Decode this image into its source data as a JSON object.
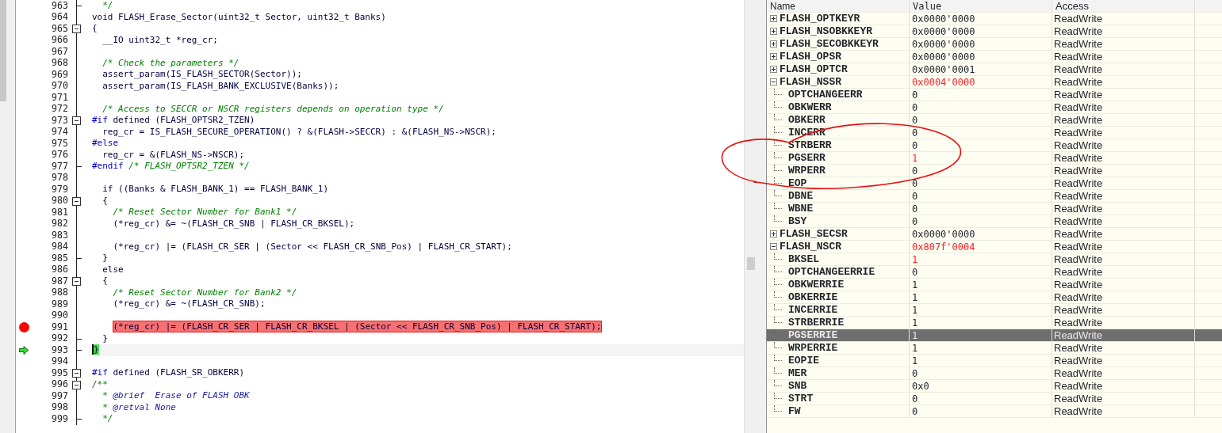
{
  "editor": {
    "lines": [
      {
        "number": "963",
        "fold_end": true,
        "tokens": [
          {
            "kind": "comment",
            "text": "  */"
          }
        ]
      },
      {
        "number": "964",
        "tokens": [
          {
            "kind": "code",
            "text": "void FLASH_Erase_Sector(uint32_t Sector, uint32_t Banks)"
          }
        ]
      },
      {
        "number": "965",
        "fold_start": true,
        "tokens": [
          {
            "kind": "code",
            "text": "{"
          }
        ]
      },
      {
        "number": "966",
        "tokens": [
          {
            "kind": "code",
            "text": "  __IO uint32_t *reg_cr;"
          }
        ]
      },
      {
        "number": "967"
      },
      {
        "number": "968",
        "tokens": [
          {
            "kind": "comment",
            "text": "  /* Check the parameters */"
          }
        ]
      },
      {
        "number": "969",
        "tokens": [
          {
            "kind": "code",
            "text": "  assert_param(IS_FLASH_SECTOR(Sector));"
          }
        ]
      },
      {
        "number": "970",
        "tokens": [
          {
            "kind": "code",
            "text": "  assert_param(IS_FLASH_BANK_EXCLUSIVE(Banks));"
          }
        ]
      },
      {
        "number": "971"
      },
      {
        "number": "972",
        "tokens": [
          {
            "kind": "comment",
            "text": "  /* Access to SECCR or NSCR registers depends on operation type */"
          }
        ]
      },
      {
        "number": "973",
        "fold_start": true,
        "tokens": [
          {
            "kind": "directive",
            "text": "#if"
          },
          {
            "kind": "code",
            "text": " defined (FLASH_OPTSR2_TZEN)"
          }
        ]
      },
      {
        "number": "974",
        "tokens": [
          {
            "kind": "code",
            "text": "  reg_cr = IS_FLASH_SECURE_OPERATION() ? &(FLASH->SECCR) : &(FLASH_NS->NSCR);"
          }
        ]
      },
      {
        "number": "975",
        "tokens": [
          {
            "kind": "directive",
            "text": "#else"
          }
        ]
      },
      {
        "number": "976",
        "tokens": [
          {
            "kind": "code",
            "text": "  reg_cr = &(FLASH_NS->NSCR);"
          }
        ]
      },
      {
        "number": "977",
        "fold_end": true,
        "tokens": [
          {
            "kind": "directive",
            "text": "#endif"
          },
          {
            "kind": "comment",
            "text": " /* FLASH_OPTSR2_TZEN */"
          }
        ]
      },
      {
        "number": "978"
      },
      {
        "number": "979",
        "tokens": [
          {
            "kind": "code",
            "text": "  if ((Banks & FLASH_BANK_1) == FLASH_BANK_1)"
          }
        ]
      },
      {
        "number": "980",
        "fold_start": true,
        "tokens": [
          {
            "kind": "code",
            "text": "  {"
          }
        ]
      },
      {
        "number": "981",
        "tokens": [
          {
            "kind": "comment",
            "text": "    /* Reset Sector Number for Bank1 */"
          }
        ]
      },
      {
        "number": "982",
        "tokens": [
          {
            "kind": "code",
            "text": "    (*reg_cr) &= ~(FLASH_CR_SNB | FLASH_CR_BKSEL);"
          }
        ]
      },
      {
        "number": "983"
      },
      {
        "number": "984",
        "tokens": [
          {
            "kind": "code",
            "text": "    (*reg_cr) |= (FLASH_CR_SER | (Sector << FLASH_CR_SNB_Pos) | FLASH_CR_START);"
          }
        ]
      },
      {
        "number": "985",
        "fold_end": true,
        "tokens": [
          {
            "kind": "code",
            "text": "  }"
          }
        ]
      },
      {
        "number": "986",
        "tokens": [
          {
            "kind": "code",
            "text": "  else"
          }
        ]
      },
      {
        "number": "987",
        "fold_start": true,
        "tokens": [
          {
            "kind": "code",
            "text": "  {"
          }
        ]
      },
      {
        "number": "988",
        "tokens": [
          {
            "kind": "comment",
            "text": "    /* Reset Sector Number for Bank2 */"
          }
        ]
      },
      {
        "number": "989",
        "tokens": [
          {
            "kind": "code",
            "text": "    (*reg_cr) &= ~(FLASH_CR_SNB);"
          }
        ]
      },
      {
        "number": "990"
      },
      {
        "number": "991",
        "breakpoint": true,
        "tokens": [
          {
            "kind": "code",
            "text": "    (*reg_cr) |= (FLASH_CR_SER | FLASH_CR_BKSEL | (Sector << FLASH_CR_SNB_Pos) | FLASH_CR_START);"
          }
        ]
      },
      {
        "number": "992",
        "fold_end": true,
        "tokens": [
          {
            "kind": "code",
            "text": "  }"
          }
        ]
      },
      {
        "number": "993",
        "fold_end": true,
        "current": true,
        "tokens": [
          {
            "kind": "code",
            "text": "}"
          }
        ]
      },
      {
        "number": "994"
      },
      {
        "number": "995",
        "fold_start": true,
        "tokens": [
          {
            "kind": "directive",
            "text": "#if"
          },
          {
            "kind": "code",
            "text": " defined (FLASH_SR_OBKERR)"
          }
        ]
      },
      {
        "number": "996",
        "fold_start": true,
        "tokens": [
          {
            "kind": "comment",
            "text": "/**"
          }
        ]
      },
      {
        "number": "997",
        "tokens": [
          {
            "kind": "comment",
            "text": "  * "
          },
          {
            "kind": "doc",
            "text": "@brief  Erase of FLASH OBK"
          }
        ]
      },
      {
        "number": "998",
        "tokens": [
          {
            "kind": "comment",
            "text": "  * "
          },
          {
            "kind": "doc",
            "text": "@retval None"
          }
        ]
      },
      {
        "number": "999",
        "fold_end": true,
        "tokens": [
          {
            "kind": "comment",
            "text": "  */"
          }
        ]
      }
    ]
  },
  "registers": {
    "columns": [
      "Name",
      "Value",
      "Access"
    ],
    "rows": [
      {
        "name": "FLASH_OPTKEYR",
        "value": "0x0000'0000",
        "access": "ReadWrite",
        "expanded": false,
        "changed": false,
        "selected": false
      },
      {
        "name": "FLASH_NSOBKKEYR",
        "value": "0x0000'0000",
        "access": "ReadWrite",
        "expanded": false,
        "changed": false,
        "selected": false
      },
      {
        "name": "FLASH_SECOBKKEYR",
        "value": "0x0000'0000",
        "access": "ReadWrite",
        "expanded": false,
        "changed": false,
        "selected": false
      },
      {
        "name": "FLASH_OPSR",
        "value": "0x0000'0000",
        "access": "ReadWrite",
        "expanded": false,
        "changed": false,
        "selected": false
      },
      {
        "name": "FLASH_OPTCR",
        "value": "0x0000'0001",
        "access": "ReadWrite",
        "expanded": false,
        "changed": false,
        "selected": false
      },
      {
        "name": "FLASH_NSSR",
        "value": "0x0004'0000",
        "access": "ReadWrite",
        "expanded": true,
        "changed": true,
        "selected": false,
        "children": [
          {
            "name": "OPTCHANGEERR",
            "value": "0",
            "access": "ReadWrite",
            "changed": false,
            "selected": false
          },
          {
            "name": "OBKWERR",
            "value": "0",
            "access": "ReadWrite",
            "changed": false,
            "selected": false
          },
          {
            "name": "OBKERR",
            "value": "0",
            "access": "ReadWrite",
            "changed": false,
            "selected": false
          },
          {
            "name": "INCERR",
            "value": "0",
            "access": "ReadWrite",
            "changed": false,
            "selected": false
          },
          {
            "name": "STRBERR",
            "value": "0",
            "access": "ReadWrite",
            "changed": false,
            "selected": false
          },
          {
            "name": "PGSERR",
            "value": "1",
            "access": "ReadWrite",
            "changed": true,
            "selected": false
          },
          {
            "name": "WRPERR",
            "value": "0",
            "access": "ReadWrite",
            "changed": false,
            "selected": false
          },
          {
            "name": "EOP",
            "value": "0",
            "access": "ReadWrite",
            "changed": false,
            "selected": false
          },
          {
            "name": "DBNE",
            "value": "0",
            "access": "ReadWrite",
            "changed": false,
            "selected": false
          },
          {
            "name": "WBNE",
            "value": "0",
            "access": "ReadWrite",
            "changed": false,
            "selected": false
          },
          {
            "name": "BSY",
            "value": "0",
            "access": "ReadWrite",
            "changed": false,
            "selected": false
          }
        ]
      },
      {
        "name": "FLASH_SECSR",
        "value": "0x0000'0000",
        "access": "ReadWrite",
        "expanded": false,
        "changed": false,
        "selected": false
      },
      {
        "name": "FLASH_NSCR",
        "value": "0x807f'0004",
        "access": "ReadWrite",
        "expanded": true,
        "changed": true,
        "selected": false,
        "children": [
          {
            "name": "BKSEL",
            "value": "1",
            "access": "ReadWrite",
            "changed": true,
            "selected": false
          },
          {
            "name": "OPTCHANGEERRIE",
            "value": "0",
            "access": "ReadWrite",
            "changed": false,
            "selected": false
          },
          {
            "name": "OBKWERRIE",
            "value": "1",
            "access": "ReadWrite",
            "changed": false,
            "selected": false
          },
          {
            "name": "OBKERRIE",
            "value": "1",
            "access": "ReadWrite",
            "changed": false,
            "selected": false
          },
          {
            "name": "INCERRIE",
            "value": "1",
            "access": "ReadWrite",
            "changed": false,
            "selected": false
          },
          {
            "name": "STRBERRIE",
            "value": "1",
            "access": "ReadWrite",
            "changed": false,
            "selected": false
          },
          {
            "name": "PGSERRIE",
            "value": "1",
            "access": "ReadWrite",
            "changed": false,
            "selected": true
          },
          {
            "name": "WRPERRIE",
            "value": "1",
            "access": "ReadWrite",
            "changed": false,
            "selected": false
          },
          {
            "name": "EOPIE",
            "value": "1",
            "access": "ReadWrite",
            "changed": false,
            "selected": false
          },
          {
            "name": "MER",
            "value": "0",
            "access": "ReadWrite",
            "changed": false,
            "selected": false
          },
          {
            "name": "SNB",
            "value": "0x0",
            "access": "ReadWrite",
            "changed": false,
            "selected": false
          },
          {
            "name": "STRT",
            "value": "0",
            "access": "ReadWrite",
            "changed": false,
            "selected": false
          },
          {
            "name": "FW",
            "value": "0",
            "access": "ReadWrite",
            "changed": false,
            "selected": false
          }
        ]
      }
    ]
  }
}
